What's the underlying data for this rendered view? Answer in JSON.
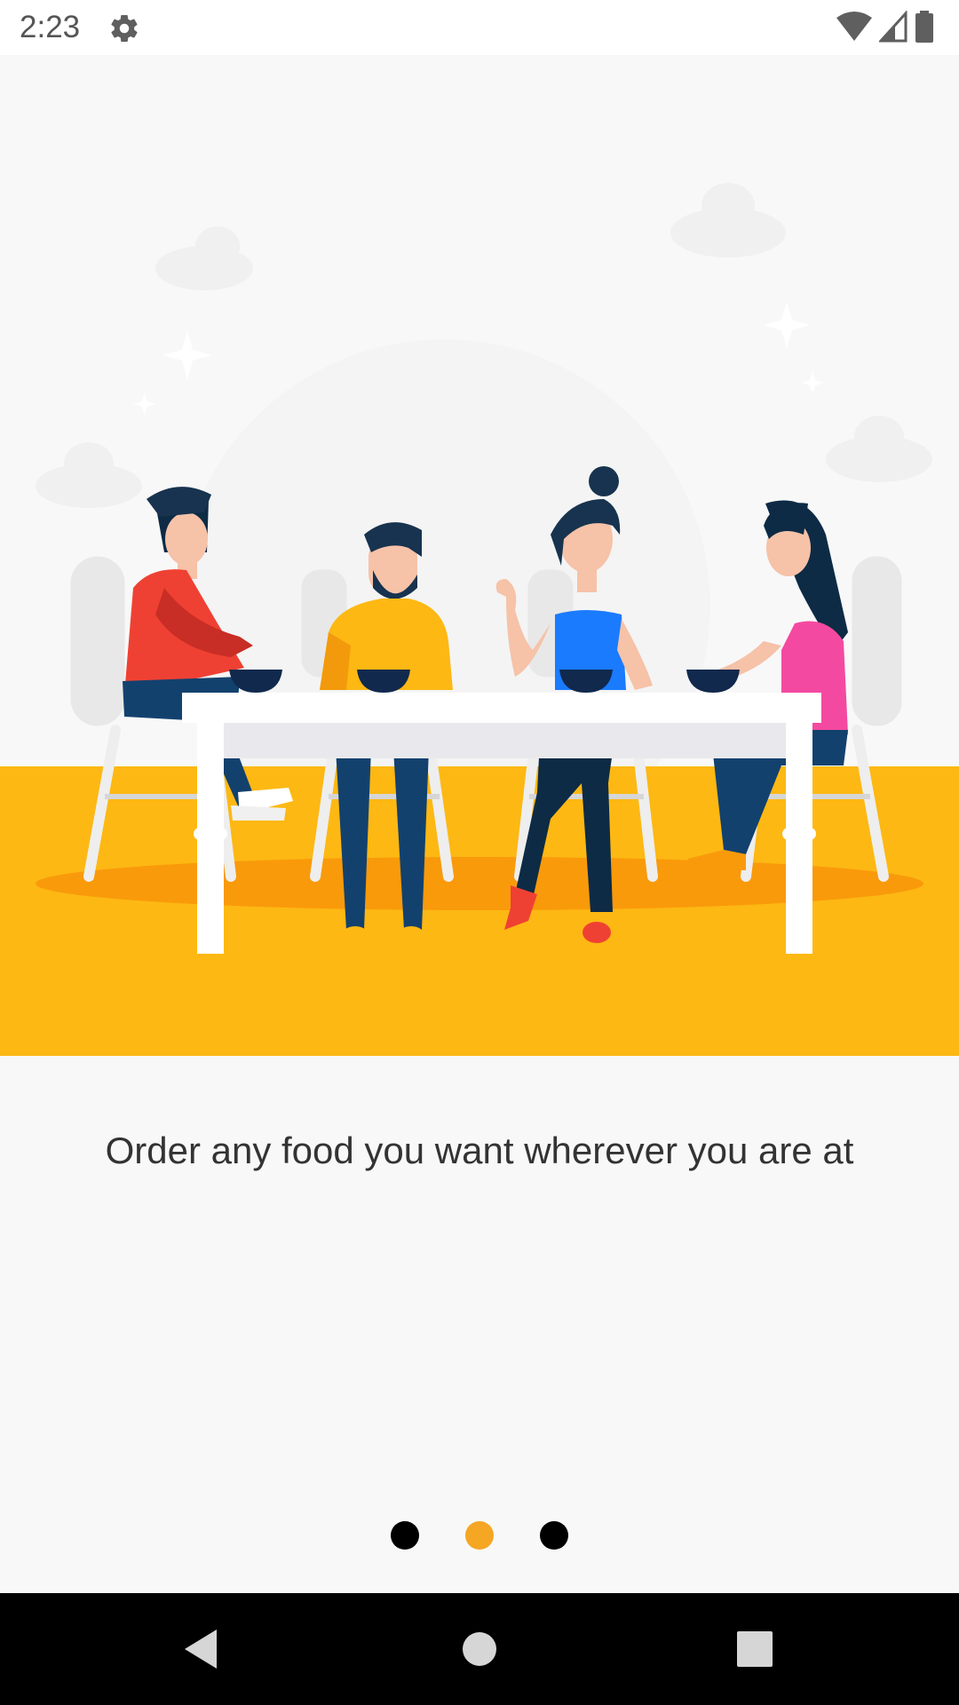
{
  "status_bar": {
    "time": "2:23",
    "icons": [
      "settings-gear-icon",
      "wifi-icon",
      "cellular-signal-icon",
      "battery-icon"
    ]
  },
  "onboarding": {
    "illustration": "people-eating-at-table-illustration",
    "caption": "Order any food you want wherever you are at",
    "page_count": 3,
    "active_page": 2,
    "colors": {
      "accent": "#F5A623",
      "floor": "#FDB813",
      "dot_inactive": "#000000",
      "background": "#F8F8F8"
    }
  },
  "nav_bar": {
    "buttons": [
      "back-icon",
      "home-icon",
      "recents-icon"
    ]
  }
}
